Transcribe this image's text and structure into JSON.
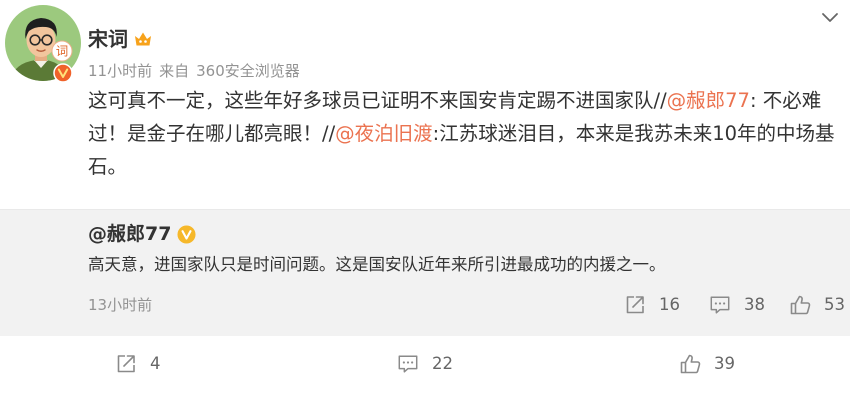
{
  "colors": {
    "text": "#333333",
    "meta": "#939393",
    "mention": "#eb7350",
    "quote_background": "#f2f2f2",
    "icon": "#8a8a8a",
    "count": "#666666",
    "verified_orange": "#f0622a",
    "verified_yellow": "#f6b82a",
    "vip": "#f7a21b",
    "avatar_background": "#9cc97e"
  },
  "post": {
    "author": {
      "name": "宋词",
      "avatar_badge_text": "词",
      "avatar_icon": "avatar-image",
      "verified": true,
      "verified_icon": "verified-badge-icon",
      "vip_member": true,
      "vip_icon": "vip-crown-icon"
    },
    "menu_icon": "chevron-down-icon",
    "meta": {
      "time": "11小时前",
      "source_prefix": "来自",
      "source": "360安全浏览器"
    },
    "content": [
      {
        "text": "这可真不一定，这些年好多球员已证明不来国安肯定踢不进国家队//",
        "mention": false
      },
      {
        "text": "@赧郎77",
        "mention": true
      },
      {
        "text": ": 不必难",
        "mention": false
      },
      {
        "text": "过！是金子在哪儿都亮眼！//",
        "mention": false
      },
      {
        "text": "@夜泊旧渡",
        "mention": true
      },
      {
        "text": ":江苏球迷泪目，本来是我苏未来10年的中场基",
        "mention": false
      },
      {
        "text": "石。",
        "mention": false
      }
    ]
  },
  "original_post": {
    "author": "@赧郎77",
    "verified": true,
    "verified_icon": "verified-badge-icon",
    "text": "高天意，进国家队只是时间问题。这是国安队近年来所引进最成功的内援之一。",
    "time": "13小时前",
    "stats": {
      "reposts": {
        "icon": "repost-icon",
        "count": "16"
      },
      "comments": {
        "icon": "comment-icon",
        "count": "38"
      },
      "likes": {
        "icon": "like-icon",
        "count": "53"
      }
    }
  },
  "actions": {
    "reposts": {
      "icon": "repost-icon",
      "count": "4"
    },
    "comments": {
      "icon": "comment-icon",
      "count": "22"
    },
    "likes": {
      "icon": "like-icon",
      "count": "39"
    }
  }
}
